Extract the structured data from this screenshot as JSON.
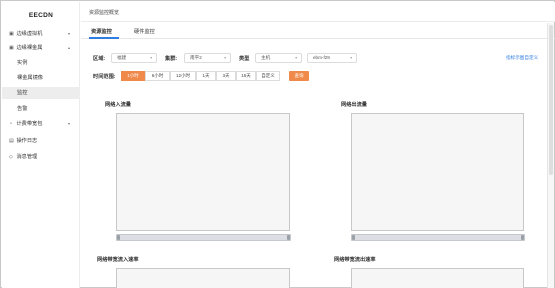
{
  "sidebar": {
    "logo": "EECDN",
    "items": [
      {
        "label": "边缘虚拟机",
        "icon": "▣",
        "chev": "▾"
      },
      {
        "label": "边缘裸金属",
        "icon": "▣",
        "chev": "▴"
      },
      {
        "label": "实例"
      },
      {
        "label": "裸金属镜像"
      },
      {
        "label": "监控"
      },
      {
        "label": "告警"
      },
      {
        "label": "计费带宽包",
        "icon": "◔",
        "chev": "▾"
      },
      {
        "label": "操作日志",
        "icon": "▤"
      },
      {
        "label": "消息管理",
        "icon": "◇"
      }
    ]
  },
  "header": {
    "breadcrumb": "资源监控概览"
  },
  "tabs": [
    "资源监控",
    "硬件监控"
  ],
  "filters": {
    "region_label": "区域:",
    "region_value": "福建",
    "cluster_label": "集群:",
    "cluster_value": "南平2",
    "type_label": "类型",
    "type_value": "主机",
    "instance_value": "ebm-f29",
    "custom_link": "指标示图自定义",
    "time_label": "时间范围:",
    "time_options": [
      "1小时",
      "6小时",
      "12小时",
      "1天",
      "3天",
      "15天",
      "自定义"
    ],
    "query_label": "查询"
  },
  "panels": {
    "in_traffic": "网络入流量",
    "out_traffic": "网络出流量",
    "in_bw": "网络带宽流入速率",
    "out_bw": "网络带宽流出速率"
  },
  "colors": {
    "accent": "#f08a4b",
    "link": "#2f7de1"
  }
}
